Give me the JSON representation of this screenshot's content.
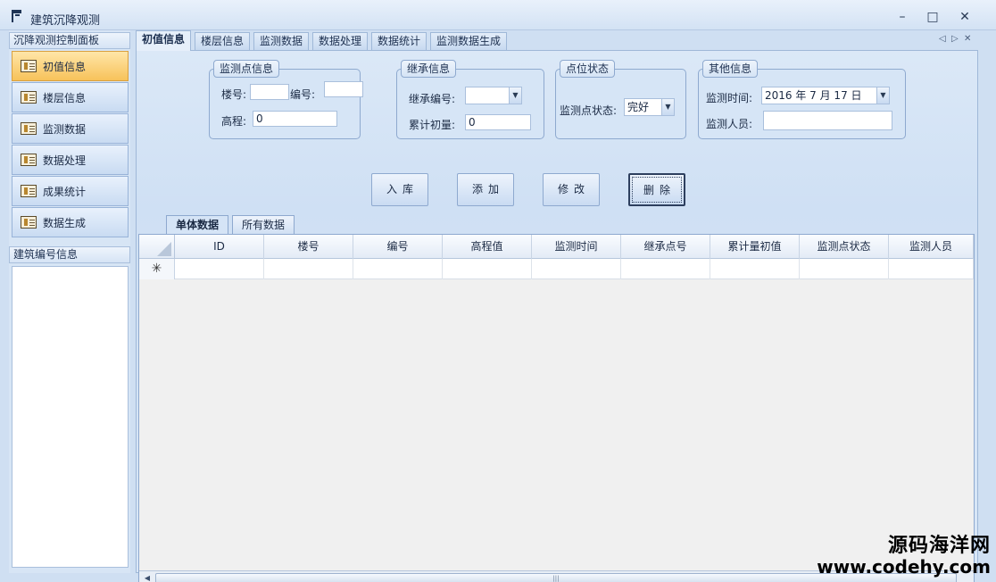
{
  "window": {
    "title": "建筑沉降观测",
    "controls": {
      "minimize": "–",
      "maximize": "□",
      "close": "✕"
    }
  },
  "sidebar": {
    "header": "沉降观测控制面板",
    "items": [
      {
        "label": "初值信息",
        "icon": "book-icon",
        "active": true
      },
      {
        "label": "楼层信息",
        "icon": "book-icon"
      },
      {
        "label": "监测数据",
        "icon": "book-icon"
      },
      {
        "label": "数据处理",
        "icon": "book-icon"
      },
      {
        "label": "成果统计",
        "icon": "book-icon"
      },
      {
        "label": "数据生成",
        "icon": "book-icon"
      }
    ],
    "building_header": "建筑编号信息"
  },
  "tabs": [
    {
      "label": "初值信息",
      "active": true
    },
    {
      "label": "楼层信息"
    },
    {
      "label": "监测数据"
    },
    {
      "label": "数据处理"
    },
    {
      "label": "数据统计"
    },
    {
      "label": "监测数据生成"
    }
  ],
  "tab_nav": {
    "prev": "◁",
    "next": "▷",
    "close": "✕"
  },
  "groups": {
    "point": {
      "title": "监测点信息",
      "floor_label": "楼号:",
      "floor_value": "",
      "number_label": "编号:",
      "number_value": "",
      "elevation_label": "高程:",
      "elevation_value": "0"
    },
    "inherit": {
      "title": "继承信息",
      "code_label": "继承编号:",
      "code_value": "",
      "cum_label": "累计初量:",
      "cum_value": "0"
    },
    "status": {
      "title": "点位状态",
      "label": "监测点状态:",
      "value": "完好"
    },
    "other": {
      "title": "其他信息",
      "time_label": "监测时间:",
      "time_value": "2016 年 7 月 17 日",
      "person_label": "监测人员:",
      "person_value": ""
    }
  },
  "actions": [
    {
      "label": "入库"
    },
    {
      "label": "添加"
    },
    {
      "label": "修改"
    },
    {
      "label": "删除",
      "focused": true
    }
  ],
  "subtabs": [
    {
      "label": "单体数据",
      "active": true
    },
    {
      "label": "所有数据"
    }
  ],
  "grid": {
    "columns": [
      "ID",
      "楼号",
      "编号",
      "高程值",
      "监测时间",
      "继承点号",
      "累计量初值",
      "监测点状态",
      "监测人员"
    ],
    "new_row_marker": "✳"
  },
  "watermark": {
    "line1": "源码海洋网",
    "line2": "www.codehy.com"
  },
  "colors": {
    "accent_active": "#f7c25a",
    "panel_bg": "#d7e5f5",
    "border": "#8ea9cf"
  }
}
